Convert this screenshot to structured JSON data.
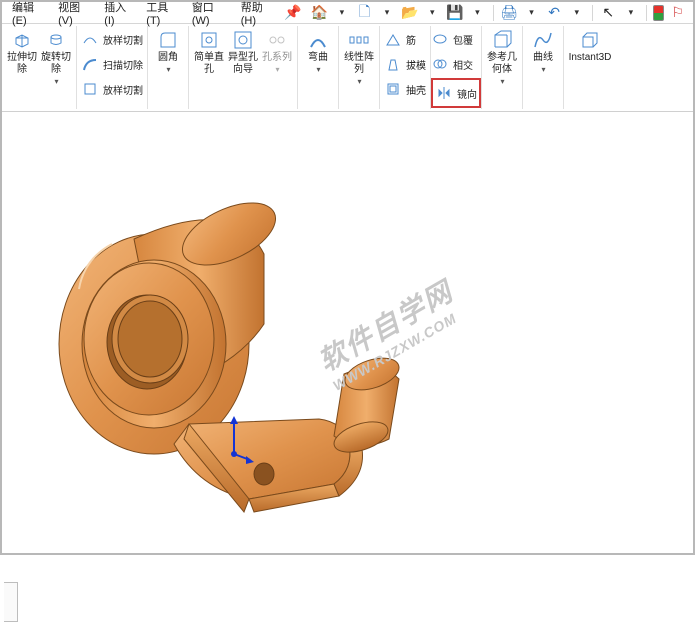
{
  "menu": {
    "edit": "编辑(E)",
    "view": "视图(V)",
    "insert": "插入(I)",
    "tool": "工具(T)",
    "window": "窗口(W)",
    "help": "帮助(H)"
  },
  "ribbon": {
    "extrude_cut": "拉伸切除",
    "revolve_cut": "旋转切除",
    "loft_cut1": "放样切割",
    "sweep_cut": "扫描切除",
    "loft_cut2": "放样切割",
    "fillet": "圆角",
    "simple_hole": "简单直孔",
    "hole_wizard": "异型孔向导",
    "hole_series": "孔系列",
    "bend": "弯曲",
    "linear_pattern": "线性阵列",
    "rib": "筋",
    "draft": "拔模",
    "shell": "抽壳",
    "wrap": "包覆",
    "intersect": "相交",
    "mirror": "镜向",
    "ref_geom": "参考几何体",
    "curve": "曲线",
    "instant3d": "Instant3D"
  },
  "watermark": {
    "main": "软件自学网",
    "sub": "WWW.RJZXW.COM"
  }
}
